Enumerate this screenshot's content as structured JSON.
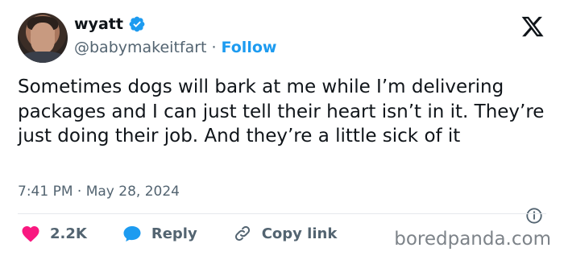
{
  "author": {
    "name": "wyatt",
    "handle": "@babymakeitfart",
    "follow_label": "Follow",
    "avatar_icon": "user-avatar"
  },
  "tweet": {
    "text": "Sometimes dogs will bark at me while I’m delivering packages and I can just tell their heart isn’t in it. They’re just doing their job. And they’re a little sick of it",
    "time": "7:41 PM",
    "date": "May 28, 2024",
    "separator": "·"
  },
  "actions": {
    "likes": "2.2K",
    "reply_label": "Reply",
    "copy_link_label": "Copy link"
  },
  "watermark": "boredpanda.com",
  "colors": {
    "accent": "#1d9bf0",
    "heart": "#f91880",
    "text": "#0f1419",
    "muted": "#536471"
  }
}
